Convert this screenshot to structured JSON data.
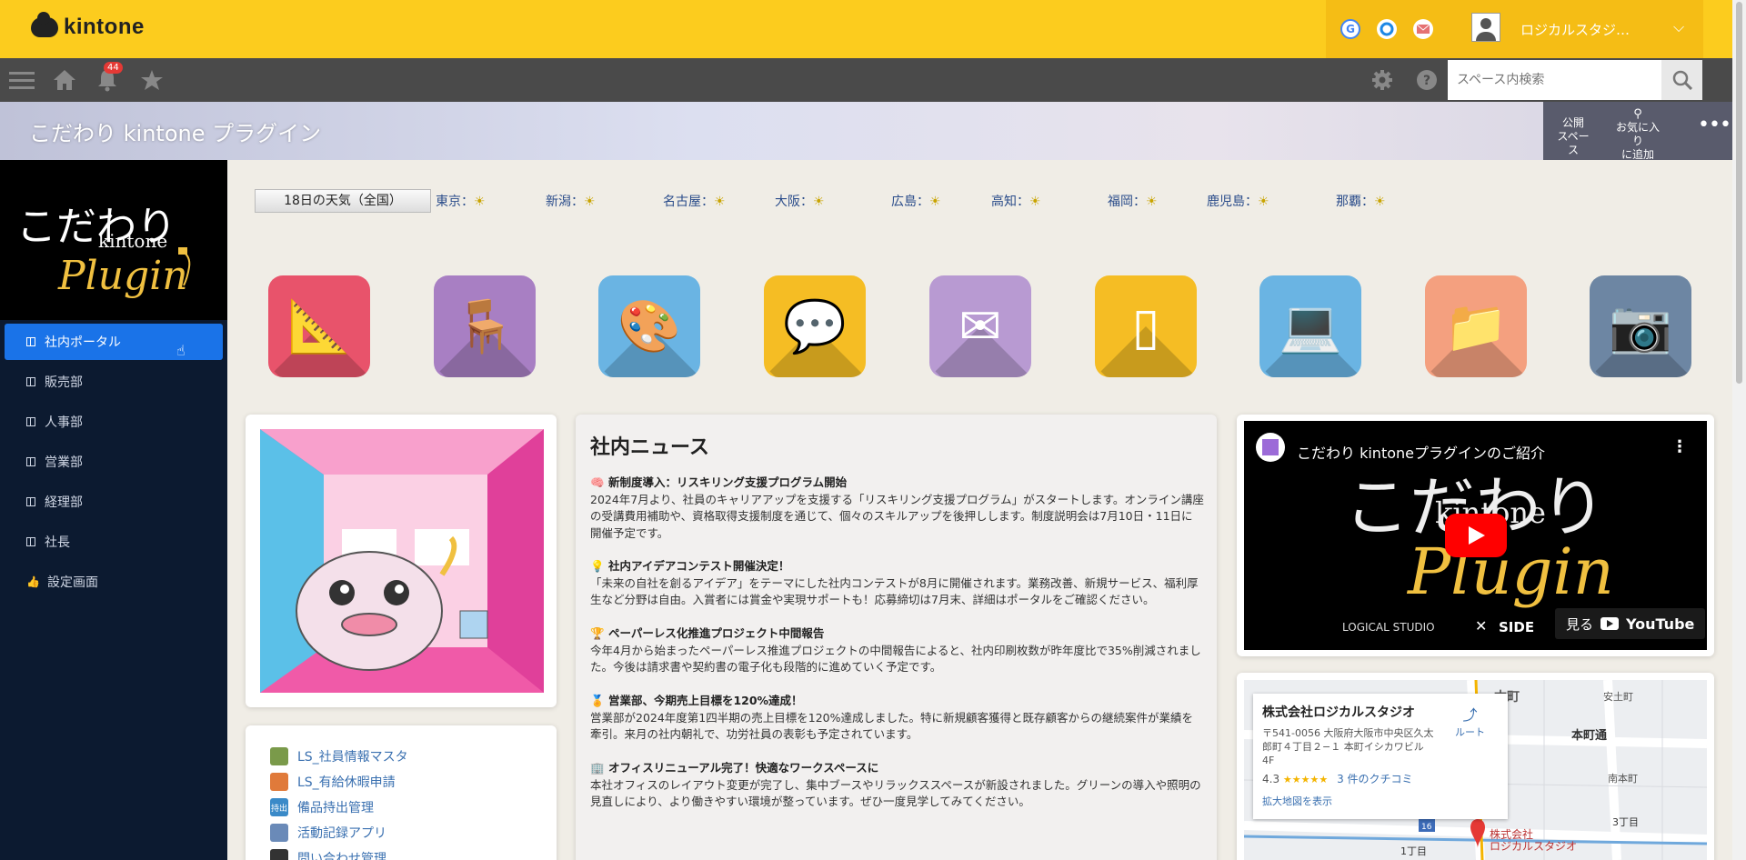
{
  "header": {
    "logo_text": "kintone",
    "user_name": "ロジカルスタジ…",
    "icons": [
      "g-icon",
      "circle-icon",
      "mail-icon",
      "user-avatar-icon"
    ]
  },
  "navbar": {
    "notification_count": "44",
    "search_placeholder": "スペース内検索"
  },
  "space": {
    "title": "こだわり kintone プラグイン",
    "actions": {
      "public": "公開\nスペース",
      "favorite_line1": "お気に入り",
      "favorite_line2": "に追加"
    }
  },
  "sidebar": {
    "logo_text": [
      "こだわり",
      "kintone",
      "Plugin"
    ],
    "items": [
      {
        "label": "社内ポータル",
        "active": true
      },
      {
        "label": "販売部"
      },
      {
        "label": "人事部"
      },
      {
        "label": "営業部"
      },
      {
        "label": "経理部"
      },
      {
        "label": "社長"
      },
      {
        "label": "設定画面"
      }
    ]
  },
  "weather": {
    "button": "18日の天気（全国）",
    "cities": [
      {
        "label": "東京："
      },
      {
        "label": "新潟："
      },
      {
        "label": "名古屋："
      },
      {
        "label": "大阪："
      },
      {
        "label": "広島："
      },
      {
        "label": "高知："
      },
      {
        "label": "福岡："
      },
      {
        "label": "鹿児島："
      },
      {
        "label": "那覇："
      }
    ]
  },
  "apps": [
    {
      "name": "ruler-app-icon",
      "color": "#e8536b"
    },
    {
      "name": "desk-app-icon",
      "color": "#a87fc3"
    },
    {
      "name": "palette-app-icon",
      "color": "#6ab4e3"
    },
    {
      "name": "chat-app-icon",
      "color": "#f5bd24"
    },
    {
      "name": "mail-app-icon",
      "color": "#b89ad2"
    },
    {
      "name": "tablet-app-icon",
      "color": "#f5bd24"
    },
    {
      "name": "laptop-app-icon",
      "color": "#6ab4e3"
    },
    {
      "name": "folder-app-icon",
      "color": "#f4a07f"
    },
    {
      "name": "camera-app-icon",
      "color": "#6d86a3"
    }
  ],
  "news": {
    "title": "社内ニュース",
    "items": [
      {
        "icon": "🧠",
        "heading": "新制度導入：リスキリング支援プログラム開始",
        "body": "2024年7月より、社員のキャリアアップを支援する「リスキリング支援プログラム」がスタートします。オンライン講座の受講費用補助や、資格取得支援制度を通じて、個々のスキルアップを後押しします。制度説明会は7月10日・11日に開催予定です。"
      },
      {
        "icon": "💡",
        "heading": "社内アイデアコンテスト開催決定！",
        "body": "「未来の自社を創るアイデア」をテーマにした社内コンテストが8月に開催されます。業務改善、新規サービス、福利厚生など分野は自由。入賞者には賞金や実現サポートも！応募締切は7月末、詳細はポータルをご確認ください。"
      },
      {
        "icon": "🏆",
        "heading": "ペーパーレス化推進プロジェクト中間報告",
        "body": "今年4月から始まったペーパーレス推進プロジェクトの中間報告によると、社内印刷枚数が昨年度比で35%削減されました。今後は請求書や契約書の電子化も段階的に進めていく予定です。"
      },
      {
        "icon": "🏅",
        "heading": "営業部、今期売上目標を120%達成！",
        "body": "営業部が2024年度第1四半期の売上目標を120%達成しました。特に新規顧客獲得と既存顧客からの継続案件が業績を牽引。来月の社内朝礼で、功労社員の表彰も予定されています。"
      },
      {
        "icon": "🏢",
        "heading": "オフィスリニューアル完了！快適なワークスペースに",
        "body": "本社オフィスのレイアウト変更が完了し、集中ブースやリラックススペースが新設されました。グリーンの導入や照明の見直しにより、より働きやすい環境が整っています。ぜひ一度見学してみてください。"
      }
    ]
  },
  "links": [
    {
      "label": "LS_社員情報マスタ",
      "color": "#7a9a4a"
    },
    {
      "label": "LS_有給休暇申請",
      "color": "#e07a3a"
    },
    {
      "label": "備品持出管理",
      "color": "#3a8ac8",
      "icon_text": "持出"
    },
    {
      "label": "活動記録アプリ",
      "color": "#6a8ab8"
    },
    {
      "label": "問い合わせ管理",
      "color": "#333333"
    }
  ],
  "video": {
    "title": "こだわり kintoneプラグインのご紹介",
    "watch_label": "見る",
    "youtube_label": "YouTube",
    "brand1": "LOGICAL STUDIO",
    "cross": "✕",
    "brand2": "SIDE",
    "big_text": [
      "こだわり",
      "kintone",
      "Plugin"
    ]
  },
  "map": {
    "company": "株式会社ロジカルスタジオ",
    "address": "〒541-0056 大阪府大阪市中央区久太郎町４丁目２−１ 本町イシカワビル 4F",
    "rating": "4.3",
    "stars": "★★★★★",
    "reviews": "3 件のクチコミ",
    "route": "ルート",
    "enlarge": "拡大地図を表示",
    "labels": [
      "本町",
      "本町通",
      "安土町",
      "南本町",
      "3丁目",
      "1丁目"
    ],
    "pin_label_line1": "株式会社",
    "pin_label_line2": "ロジカルスタジオ",
    "road_number": "16"
  }
}
